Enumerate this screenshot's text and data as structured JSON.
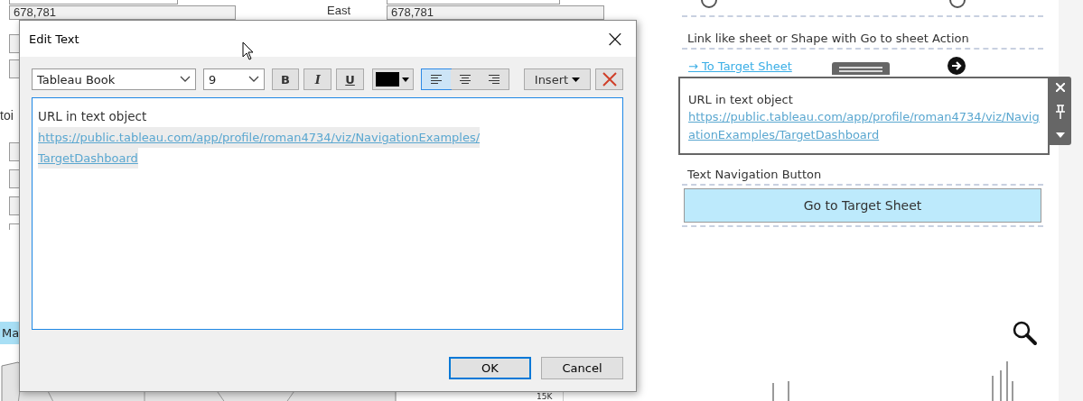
{
  "dashboard": {
    "fields": [
      {
        "value": "678,781",
        "kind": "wide"
      },
      {
        "value": "678,781",
        "kind": "wide"
      }
    ],
    "labels": [
      {
        "text": "East",
        "kind": "region"
      },
      {
        "text": "toi",
        "kind": "cut"
      }
    ],
    "map_button": {
      "label": "Ma"
    },
    "axis_label": "15K"
  },
  "right_panel": {
    "heading": "Link like sheet or Shape with Go to sheet Action",
    "link": "→ To Target Sheet",
    "text_object": {
      "selected": true,
      "title": "URL in text object",
      "url": "https://public.tableau.com/app/profile/roman4734/viz/NavigationExamples/TargetDashboard"
    },
    "button_heading": "Text Navigation Button",
    "button": "Go to Target Sheet"
  },
  "dialog": {
    "title": "Edit Text",
    "close": "×",
    "font": "Tableau Book",
    "size": "9",
    "styles": [
      {
        "label": "B",
        "kind": "bold",
        "selected": false
      },
      {
        "label": "I",
        "kind": "italic",
        "selected": false
      },
      {
        "label": "U",
        "kind": "underline",
        "selected": false
      }
    ],
    "color_button": {
      "color": "#000000"
    },
    "alignments": [
      {
        "kind": "left",
        "selected": true
      },
      {
        "kind": "center",
        "selected": false
      },
      {
        "kind": "right",
        "selected": false
      }
    ],
    "insert": "Insert",
    "content": [
      {
        "kind": "plain",
        "text": "URL in text object"
      },
      {
        "kind": "link",
        "text": "https://public.tableau.com/app/profile/roman4734/viz/NavigationExamples/"
      },
      {
        "kind": "link",
        "text": "TargetDashboard"
      }
    ],
    "buttons": [
      {
        "label": "OK",
        "kind": "default"
      },
      {
        "label": "Cancel",
        "kind": "normal"
      }
    ]
  }
}
